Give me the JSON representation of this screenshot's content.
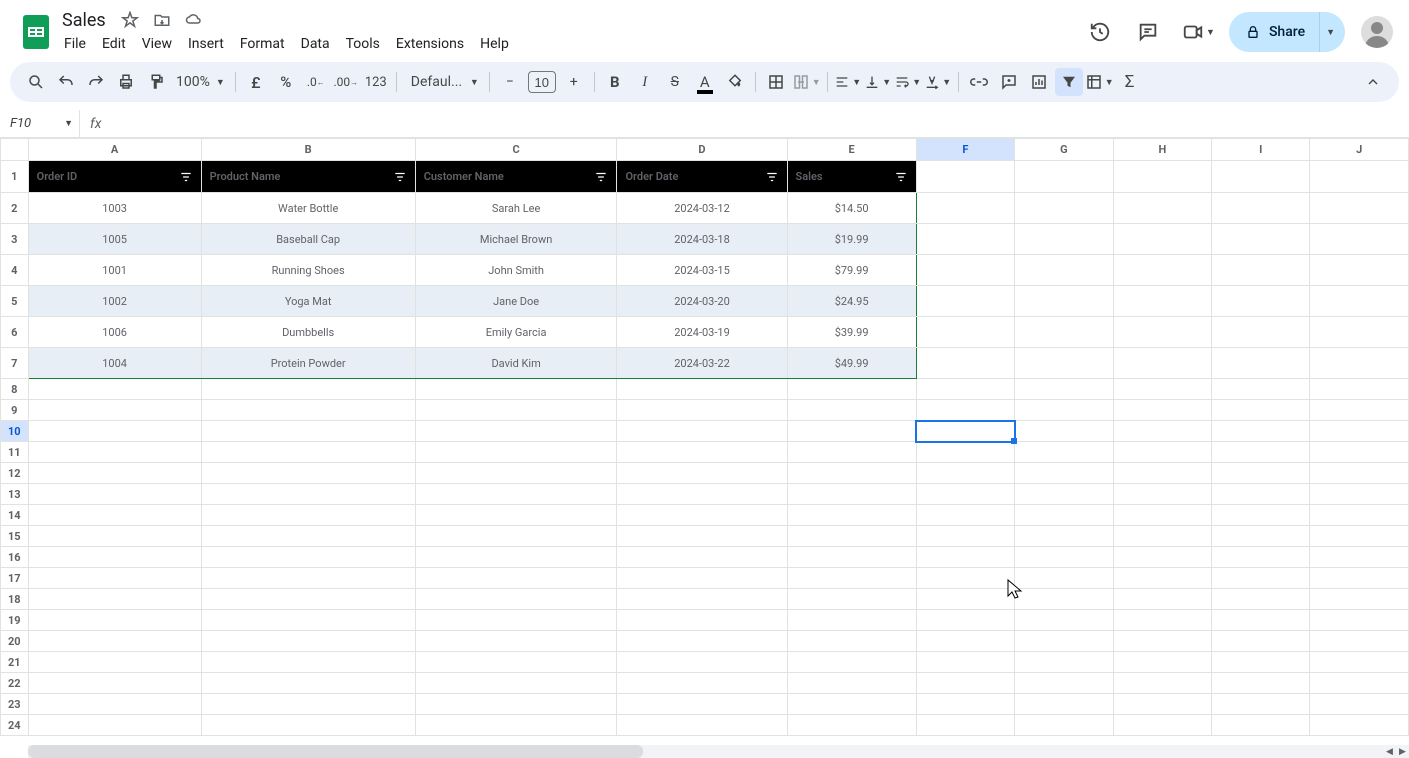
{
  "doc": {
    "title": "Sales"
  },
  "menus": [
    "File",
    "Edit",
    "View",
    "Insert",
    "Format",
    "Data",
    "Tools",
    "Extensions",
    "Help"
  ],
  "toolbar": {
    "zoom": "100%",
    "font": "Defaul...",
    "font_size": "10"
  },
  "share_label": "Share",
  "name_box": "F10",
  "columns": [
    "A",
    "B",
    "C",
    "D",
    "E",
    "F",
    "G",
    "H",
    "I",
    "J"
  ],
  "active_col": "F",
  "active_row": 10,
  "table": {
    "headers": [
      "Order ID",
      "Product Name",
      "Customer Name",
      "Order Date",
      "Sales"
    ],
    "rows": [
      {
        "id": "1003",
        "product": "Water Bottle",
        "customer": "Sarah Lee",
        "date": "2024-03-12",
        "sales": "$14.50"
      },
      {
        "id": "1005",
        "product": "Baseball Cap",
        "customer": "Michael Brown",
        "date": "2024-03-18",
        "sales": "$19.99"
      },
      {
        "id": "1001",
        "product": "Running Shoes",
        "customer": "John Smith",
        "date": "2024-03-15",
        "sales": "$79.99"
      },
      {
        "id": "1002",
        "product": "Yoga Mat",
        "customer": "Jane Doe",
        "date": "2024-03-20",
        "sales": "$24.95"
      },
      {
        "id": "1006",
        "product": "Dumbbells",
        "customer": "Emily Garcia",
        "date": "2024-03-19",
        "sales": "$39.99"
      },
      {
        "id": "1004",
        "product": "Protein Powder",
        "customer": "David Kim",
        "date": "2024-03-22",
        "sales": "$49.99"
      }
    ]
  },
  "total_rows": 24,
  "chart_data": {
    "type": "table",
    "headers": [
      "Order ID",
      "Product Name",
      "Customer Name",
      "Order Date",
      "Sales"
    ],
    "rows": [
      [
        "1003",
        "Water Bottle",
        "Sarah Lee",
        "2024-03-12",
        14.5
      ],
      [
        "1005",
        "Baseball Cap",
        "Michael Brown",
        "2024-03-18",
        19.99
      ],
      [
        "1001",
        "Running Shoes",
        "John Smith",
        "2024-03-15",
        79.99
      ],
      [
        "1002",
        "Yoga Mat",
        "Jane Doe",
        "2024-03-20",
        24.95
      ],
      [
        "1006",
        "Dumbbells",
        "Emily Garcia",
        "2024-03-19",
        39.99
      ],
      [
        "1004",
        "Protein Powder",
        "David Kim",
        "2024-03-22",
        49.99
      ]
    ]
  }
}
